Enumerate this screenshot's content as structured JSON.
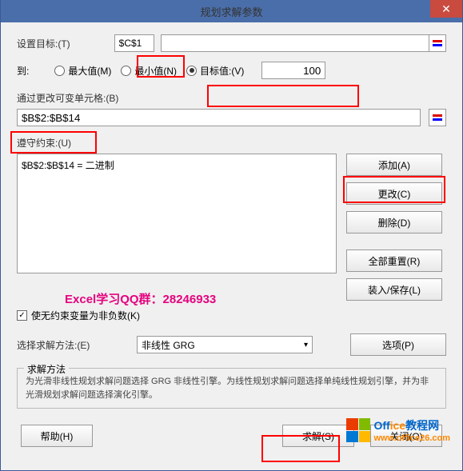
{
  "title": "规划求解参数",
  "setTarget": {
    "label": "设置目标:(T)",
    "value": "$C$1"
  },
  "to": {
    "label": "到:",
    "max": "最大值(M)",
    "min": "最小值(N)",
    "target": "目标值:(V)",
    "targetValue": "100"
  },
  "changeVar": {
    "label": "通过更改可变单元格:(B)",
    "value": "$B$2:$B$14"
  },
  "constraints": {
    "label": "遵守约束:(U)",
    "line1": "$B$2:$B$14 = 二进制"
  },
  "buttons": {
    "add": "添加(A)",
    "change": "更改(C)",
    "delete": "删除(D)",
    "resetAll": "全部重置(R)",
    "loadSave": "装入/保存(L)",
    "options": "选项(P)",
    "help": "帮助(H)",
    "solve": "求解(S)",
    "close": "关闭(O)"
  },
  "nonneg": {
    "label": "使无约束变量为非负数(K)"
  },
  "method": {
    "label": "选择求解方法:(E)",
    "value": "非线性 GRG"
  },
  "desc": {
    "title": "求解方法",
    "text": "为光滑非线性规划求解问题选择 GRG 非线性引擎。为线性规划求解问题选择单纯线性规划引擎，并为非光滑规划求解问题选择演化引擎。"
  },
  "qq": "Excel学习QQ群：28246933",
  "logo": {
    "brand": "Office教程网",
    "url": "www.office26.com"
  }
}
